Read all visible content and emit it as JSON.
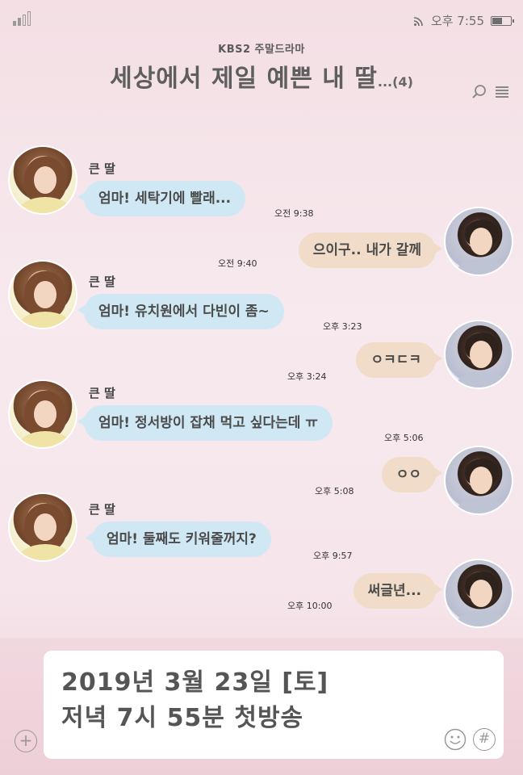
{
  "status_bar": {
    "time": "오후 7:55",
    "battery_level": 0.55
  },
  "header": {
    "network": "KBS2 주말드라마",
    "title": "세상에서 제일 예쁜 내 딸",
    "title_suffix": "...(4)"
  },
  "messages": [
    {
      "side": "in",
      "sender": "큰 딸",
      "text": "엄마! 세탁기에 빨래...",
      "time": "오전 9:38"
    },
    {
      "side": "out",
      "text": "으이구.. 내가 갈께",
      "time": "오전 9:40"
    },
    {
      "side": "in",
      "sender": "큰 딸",
      "text": "엄마! 유치원에서 다빈이 좀~",
      "time": "오후 3:23"
    },
    {
      "side": "out",
      "text": "ㅇㅋㄷㅋ",
      "time": "오후 3:24"
    },
    {
      "side": "in",
      "sender": "큰 딸",
      "text": "엄마! 정서방이 잡채 먹고 싶다는데 ㅠ",
      "time": "오후 5:06"
    },
    {
      "side": "out",
      "text": "ㅇㅇ",
      "time": "오후 5:08"
    },
    {
      "side": "in",
      "sender": "큰 딸",
      "text": "엄마! 둘째도 키워줄꺼지?",
      "time": "오후 9:57"
    },
    {
      "side": "out",
      "text": "써글년...",
      "time": "오후 10:00"
    }
  ],
  "input": {
    "line1": "2019년 3월 23일 [토]",
    "line2": "저녁 7시 55분 첫방송"
  },
  "icons": {
    "signal": "signal-icon",
    "wifi": "wifi-icon",
    "battery": "battery-icon",
    "search": "search-icon",
    "menu": "menu-icon",
    "plus": "plus-icon",
    "emoji": "emoji-icon",
    "hash": "hash-icon"
  }
}
